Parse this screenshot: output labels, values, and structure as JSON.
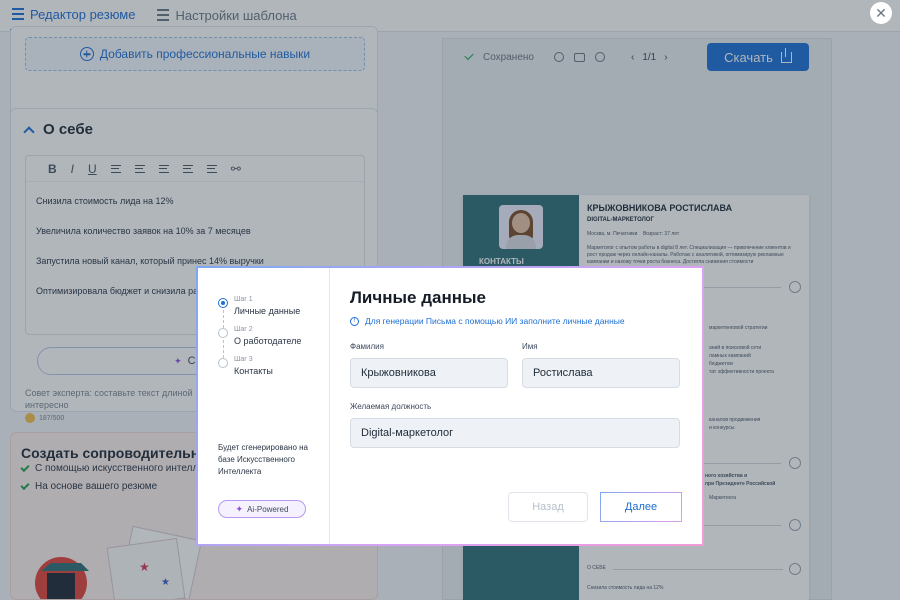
{
  "tabs": {
    "editor": "Редактор резюме",
    "settings": "Настройки шаблона"
  },
  "left": {
    "add_skills": "Добавить профессиональные навыки",
    "about_title": "О себе",
    "editor_lines": [
      "Снизила стоимость лида на 12%",
      "Увеличила количество заявок на 10% за 7 месяцев",
      "Запустила новый канал, который принес 14% выручки",
      "Оптимизировала бюджет и снизила рас"
    ],
    "generate_btn": "Сгенери",
    "advice_line1": "Совет эксперта: составьте текст длиной",
    "advice_line2": "интересно",
    "counter": "187/500",
    "promo_title": "Создать сопроводительное",
    "promo_items": [
      "С помощью искусственного интеллекта",
      "На основе вашего резюме"
    ]
  },
  "preview": {
    "saved": "Сохранено",
    "page": "1/1",
    "download": "Скачать",
    "name": "КРЫЖОВНИКОВА РОСТИСЛАВА",
    "role": "DIGITAL-МАРКЕТОЛОГ",
    "location": "Москва, м. Печатники",
    "age": "Возраст: 37 лет",
    "contacts": "КОНТАКТЫ",
    "summary": "Маркетолог с опытом работы в digital 8 лет. Специализация — привлечение клиентов и рост продаж через онлайн-каналы. Работаю с аналитикой, оптимизирую рекламные кампании и нахожу точки роста бизнеса. Достигла снижения стоимости",
    "frag1": "маркетинговой стратегии",
    "frag2": "аний в поисковой сети",
    "frag3": "ламных кампаний",
    "frag4": "бюджетом",
    "frag5": "тат эффективности проекта",
    "frag6": "каналов продвижения",
    "frag7": "и конкурсы",
    "frag8": "ного хозяйства и",
    "frag9": "при Президенте Российской",
    "frag10": "Маркетинга",
    "about_label": "О СЕБЕ",
    "about_text": "Снизила стоимость лида на 12%"
  },
  "modal": {
    "steps": [
      {
        "num": "Шаг 1",
        "title": "Личные данные"
      },
      {
        "num": "Шаг 2",
        "title": "О работодателе"
      },
      {
        "num": "Шаг 3",
        "title": "Контакты"
      }
    ],
    "gen_note": "Будет сгенерировано на базе Искусственного Интеллекта",
    "ai_pill": "Ai-Powered",
    "title": "Личные данные",
    "hint": "Для генерации Письма с помощью ИИ заполните личные данные",
    "last_name_label": "Фамилия",
    "last_name_value": "Крыжовникова",
    "first_name_label": "Имя",
    "first_name_value": "Ростислава",
    "position_label": "Желаемая должность",
    "position_value": "Digital-маркетолог",
    "back": "Назад",
    "next": "Далее"
  },
  "colors": {
    "accent": "#1d6fd6",
    "resume_sidebar": "#2f6f78",
    "success": "#22a455"
  }
}
